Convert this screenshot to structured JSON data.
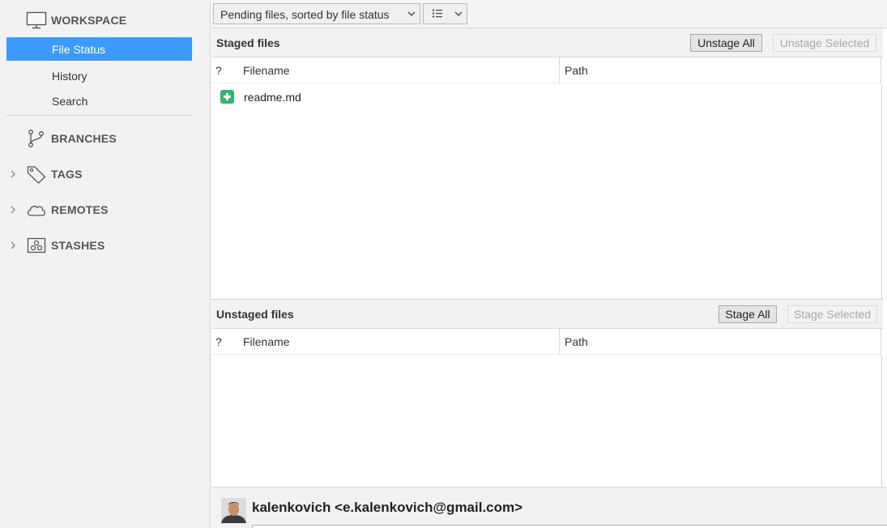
{
  "sidebar": {
    "workspace_label": "WORKSPACE",
    "items": [
      {
        "label": "File Status"
      },
      {
        "label": "History"
      },
      {
        "label": "Search"
      }
    ],
    "branches_label": "BRANCHES",
    "tags_label": "TAGS",
    "remotes_label": "REMOTES",
    "stashes_label": "STASHES",
    "accent_color": "#3c9bfa"
  },
  "toolbar": {
    "filter_value": "Pending files, sorted by file status",
    "view_icon": "list-view-icon"
  },
  "staged": {
    "title": "Staged files",
    "unstage_all": "Unstage All",
    "unstage_selected": "Unstage Selected",
    "columns": {
      "status": "?",
      "filename": "Filename",
      "path": "Path"
    },
    "files": [
      {
        "status": "added",
        "status_icon": "added-file-icon",
        "filename": "readme.md",
        "path": ""
      }
    ]
  },
  "unstaged": {
    "title": "Unstaged files",
    "stage_all": "Stage All",
    "stage_selected": "Stage Selected",
    "columns": {
      "status": "?",
      "filename": "Filename",
      "path": "Path"
    },
    "files": []
  },
  "commit": {
    "author": "kalenkovich <e.kalenkovich@gmail.com>"
  }
}
